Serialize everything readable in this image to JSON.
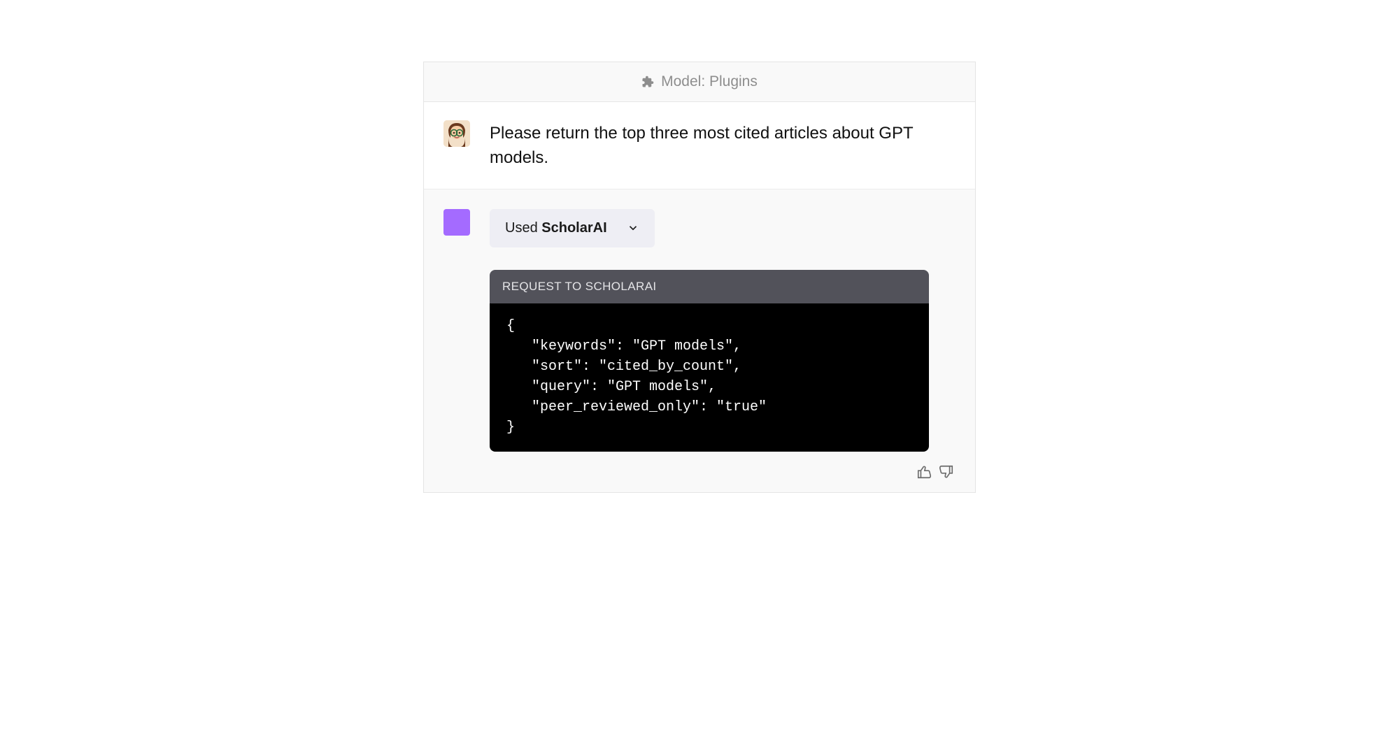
{
  "model_bar": {
    "label": "Model: Plugins"
  },
  "user_message": {
    "text": "Please return the top three most cited articles about GPT models."
  },
  "assistant": {
    "plugin_chip": {
      "used_label": "Used",
      "plugin_name": "ScholarAI"
    },
    "code": {
      "header": "REQUEST TO SCHOLARAI",
      "body": "{\n   \"keywords\": \"GPT models\",\n   \"sort\": \"cited_by_count\",\n   \"query\": \"GPT models\",\n   \"peer_reviewed_only\": \"true\"\n}"
    }
  }
}
